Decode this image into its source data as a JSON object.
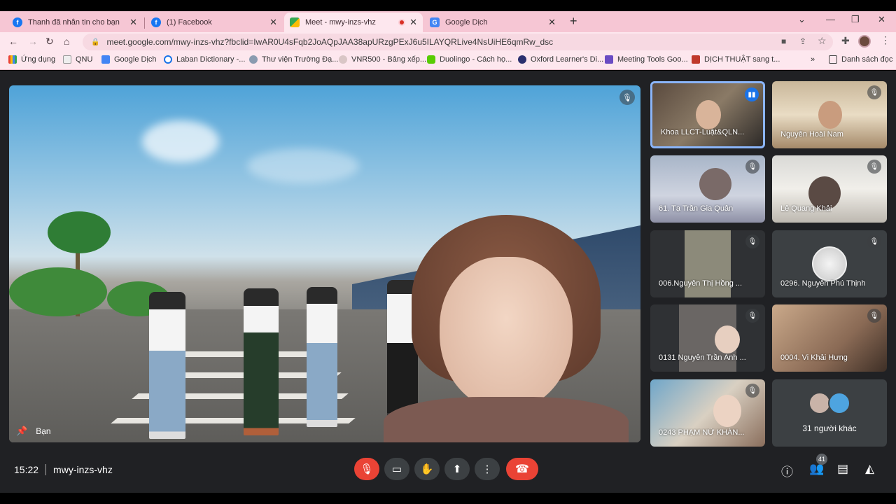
{
  "browser": {
    "tabs": [
      {
        "title": "Thanh đã nhắn tin cho bạn",
        "favicon": "facebook-icon",
        "active": false
      },
      {
        "title": "(1) Facebook",
        "favicon": "facebook-icon",
        "active": false
      },
      {
        "title": "Meet - mwy-inzs-vhz",
        "favicon": "google-meet-icon",
        "active": true
      },
      {
        "title": "Google Dịch",
        "favicon": "google-translate-icon",
        "active": false
      }
    ],
    "url": "meet.google.com/mwy-inzs-vhz?fbclid=IwAR0U4sFqb2JoAQpJAA38apURzgPExJ6u5ILAYQRLive4NsUiHE6qmRw_dsc",
    "bookmarks": [
      "Ứng dụng",
      "QNU",
      "Google Dịch",
      "Laban Dictionary -...",
      "Thư viện Trường Đạ...",
      "VNR500 - Bảng xếp...",
      "Duolingo - Cách họ...",
      "Oxford Learner's Di...",
      "Meeting Tools Goo...",
      "DỊCH THUẬT sang t..."
    ],
    "reading_list": "Danh sách đọc"
  },
  "meet": {
    "main_tile_name": "Bạn",
    "participants": [
      {
        "name": "Khoa LLCT-Luật&QLN...",
        "speaking": true
      },
      {
        "name": "Nguyễn Hoài Nam",
        "speaking": false
      },
      {
        "name": "61. Tạ Trần Gia Quân",
        "speaking": false
      },
      {
        "name": "Lê Quang Khải",
        "speaking": false
      },
      {
        "name": "006.Nguyễn Thị Hồng ...",
        "speaking": false
      },
      {
        "name": "0296. Nguyễn Phú Thịnh",
        "speaking": false
      },
      {
        "name": "0131 Nguyễn Trần Anh ...",
        "speaking": false
      },
      {
        "name": "0004. Vi Khải Hưng",
        "speaking": false
      },
      {
        "name": "0243 PHẠM NỮ KHÁN...",
        "speaking": false
      }
    ],
    "others_label": "31 người khác",
    "time": "15:22",
    "meeting_code": "mwy-inzs-vhz",
    "participant_count": "41"
  },
  "colors": {
    "tabstrip": "#f6c6d4",
    "meet_bg": "#202124",
    "hangup": "#ea4335",
    "speaking_border": "#8ab4f8"
  }
}
